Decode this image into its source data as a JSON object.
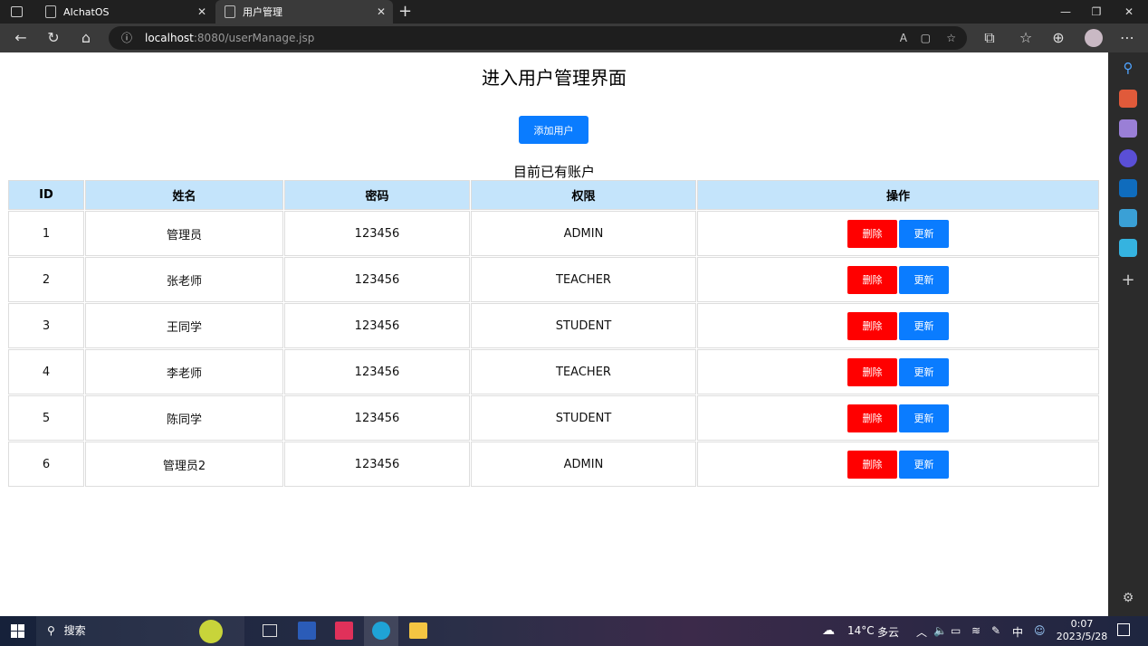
{
  "browser": {
    "tabs": [
      {
        "label": "AIchatOS"
      },
      {
        "label": "用户管理"
      }
    ],
    "url_host": "localhost",
    "url_rest": ":8080/userManage.jsp"
  },
  "page": {
    "title": "进入用户管理界面",
    "add_button": "添加用户",
    "subtitle": "目前已有账户",
    "columns": [
      "ID",
      "姓名",
      "密码",
      "权限",
      "操作"
    ],
    "rows": [
      {
        "id": "1",
        "name": "管理员",
        "password": "123456",
        "role": "ADMIN"
      },
      {
        "id": "2",
        "name": "张老师",
        "password": "123456",
        "role": "TEACHER"
      },
      {
        "id": "3",
        "name": "王同学",
        "password": "123456",
        "role": "STUDENT"
      },
      {
        "id": "4",
        "name": "李老师",
        "password": "123456",
        "role": "TEACHER"
      },
      {
        "id": "5",
        "name": "陈同学",
        "password": "123456",
        "role": "STUDENT"
      },
      {
        "id": "6",
        "name": "管理员2",
        "password": "123456",
        "role": "ADMIN"
      }
    ],
    "delete_label": "删除",
    "update_label": "更新"
  },
  "taskbar": {
    "search": "搜索",
    "weather_temp": "14°C",
    "weather_desc": "多云",
    "ime": "中",
    "time": "0:07",
    "date": "2023/5/28"
  },
  "colors": {
    "header_bg": "#c4e4fb",
    "primary": "#0a7cff",
    "danger": "#ff0000"
  }
}
